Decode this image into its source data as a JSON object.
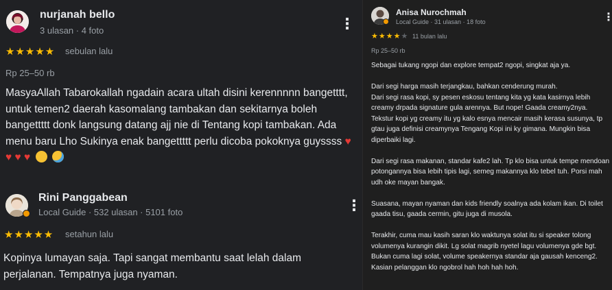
{
  "colors": {
    "background": "#202124",
    "text": "#e8eaed",
    "muted": "#9aa0a6",
    "star": "#fbbc04"
  },
  "reviews_left": [
    {
      "name": "nurjanah bello",
      "meta": "3 ulasan · 4 foto",
      "rating_stars": "★★★★★",
      "rating": 5,
      "ago": "sebulan lalu",
      "price": "Rp 25–50 rb",
      "text": "MasyaAllah Tabarokallah ngadain acara ultah disini kerennnnn bangetttt, untuk temen2 daerah kasomalang tambakan dan sekitarnya boleh bangettttt donk langsung datang ajj nie di Tentang kopi tambakan. Ada menu baru Lho Sukinya enak bangettttt perlu dicoba pokoknya guyssss",
      "emojis": "♥ ♥ ♥ ♥",
      "avatar_icon": "user-avatar-icon",
      "menu_icon": "more-vertical-icon"
    },
    {
      "name": "Rini Panggabean",
      "meta": "Local Guide · 532 ulasan · 5101 foto",
      "rating_stars": "★★★★★",
      "rating": 5,
      "ago": "setahun lalu",
      "text": "Kopinya lumayan saja. Tapi sangat membantu saat lelah dalam perjalanan. Tempatnya juga nyaman.",
      "avatar_icon": "user-avatar-icon",
      "menu_icon": "more-vertical-icon"
    }
  ],
  "review_right": {
    "name": "Anisa Nurochmah",
    "meta": "Local Guide · 31 ulasan · 18 foto",
    "rating_stars": "★★★★",
    "rating_empty": "★",
    "rating": 4,
    "ago": "11 bulan lalu",
    "price": "Rp 25–50 rb",
    "paragraphs": [
      "Sebagai tukang ngopi dan explore tempat2 ngopi, singkat aja ya.",
      "Dari segi harga masih terjangkau, bahkan cenderung murah.\nDari segi rasa kopi, sy pesen eskosu tentang kita yg kata kasirnya lebih creamy drpada signature gula arennya. But nope! Gaada creamy2nya. Tekstur kopi yg creamy itu yg kalo esnya mencair masih kerasa susunya, tp gtau juga definisi creamynya Tengang Kopi ini ky gimana. Mungkin bisa diperbaiki lagi.",
      "Dari segi rasa makanan, standar kafe2 lah. Tp klo bisa untuk tempe mendoan potongannya bisa lebih tipis lagi, semeg makannya klo tebel tuh. Porsi mah udh oke mayan bangak.",
      "Suasana, mayan nyaman dan kids friendly soalnya ada kolam ikan. Di toilet gaada tisu, gaada cermin, gitu juga di musola.",
      "Terakhir, cuma mau kasih saran klo waktunya solat itu si speaker tolong volumenya kurangin dikit. Lg solat magrib nyetel lagu volumenya gde bgt.\nBukan cuma lagi solat, volume speakernya standar aja gausah kenceng2. Kasian pelanggan klo ngobrol hah hoh hah hoh."
    ],
    "avatar_icon": "user-avatar-icon",
    "menu_icon": "more-vertical-icon"
  }
}
